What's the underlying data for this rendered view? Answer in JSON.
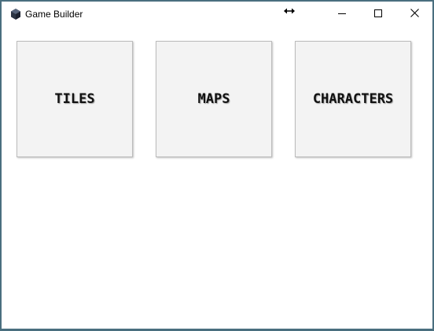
{
  "window": {
    "title": "Game Builder",
    "icon": "game-builder-app-icon"
  },
  "controls": {
    "minimize_icon": "minimize-icon",
    "maximize_icon": "maximize-icon",
    "close_icon": "close-icon"
  },
  "cursor": {
    "icon": "horizontal-resize-cursor-icon"
  },
  "menu": {
    "tiles": [
      {
        "label": "TILES"
      },
      {
        "label": "MAPS"
      },
      {
        "label": "CHARACTERS"
      }
    ]
  },
  "colors": {
    "border": "#4a6f7f",
    "tile_background": "#f3f3f3",
    "tile_border": "#bcbcbc"
  }
}
